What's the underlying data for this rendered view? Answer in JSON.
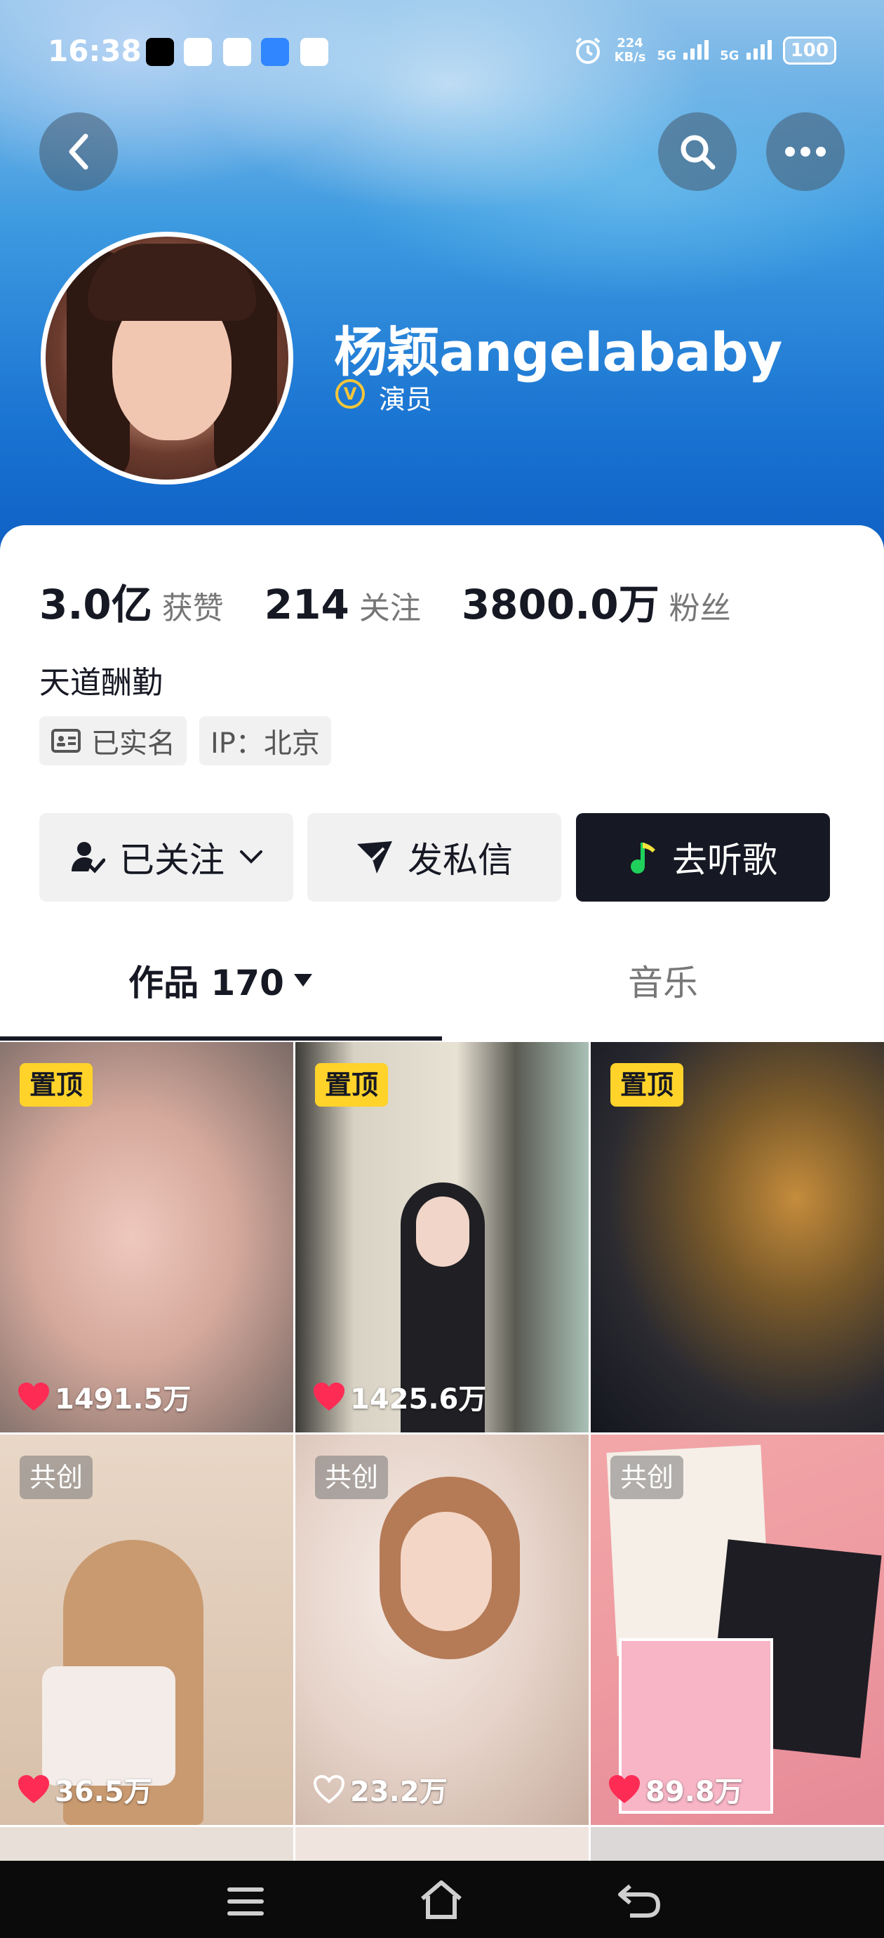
{
  "status_bar": {
    "time": "16:38",
    "net_speed": "224",
    "net_unit": "KB/s",
    "sim1": "5G",
    "sim2": "5G",
    "battery": "100"
  },
  "profile": {
    "name": "杨颖angelababy",
    "verified_badge": "V",
    "title": "演员",
    "stats": [
      {
        "value": "3.0亿",
        "label": "获赞"
      },
      {
        "value": "214",
        "label": "关注"
      },
      {
        "value": "3800.0万",
        "label": "粉丝"
      }
    ],
    "bio": "天道酬勤",
    "chips": {
      "realname": "已实名",
      "ip": "IP：北京"
    }
  },
  "actions": {
    "follow": "已关注",
    "message": "发私信",
    "music": "去听歌"
  },
  "tabs": {
    "works": "作品 170",
    "music": "音乐"
  },
  "grid": [
    {
      "tag": "置顶",
      "tag_type": "pin",
      "likes": "1491.5万",
      "liked": true
    },
    {
      "tag": "置顶",
      "tag_type": "pin",
      "likes": "1425.6万",
      "liked": true
    },
    {
      "tag": "置顶",
      "tag_type": "pin",
      "likes": "",
      "liked": false
    },
    {
      "tag": "共创",
      "tag_type": "co",
      "likes": "36.5万",
      "liked": true
    },
    {
      "tag": "共创",
      "tag_type": "co",
      "likes": "23.2万",
      "liked": false
    },
    {
      "tag": "共创",
      "tag_type": "co",
      "likes": "89.8万",
      "liked": true
    }
  ],
  "colors": {
    "accent_pin": "#ffd32a",
    "like_red": "#fe2c55",
    "text_dark": "#161823"
  },
  "icons": [
    "back-icon",
    "search-icon",
    "more-icon",
    "person-check-icon",
    "chevron-down-icon",
    "send-icon",
    "music-note-icon",
    "caret-down-icon",
    "heart-icon",
    "id-card-icon",
    "menu-icon",
    "home-icon",
    "return-icon"
  ]
}
